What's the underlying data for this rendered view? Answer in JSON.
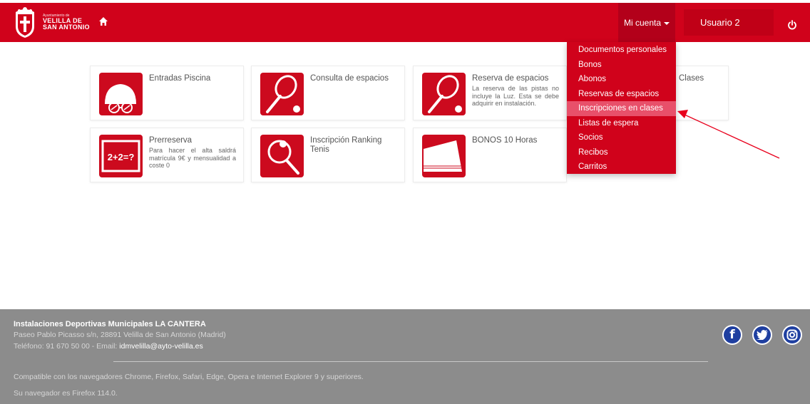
{
  "header": {
    "logo_small": "Ayuntamiento de",
    "logo_line1": "VELILLA DE",
    "logo_line2": "SAN ANTONIO",
    "account_label": "Mi cuenta",
    "user_label": "Usuario 2",
    "brand_color": "#d0021b"
  },
  "dropdown": {
    "items": [
      {
        "label": "Documentos personales"
      },
      {
        "label": "Bonos"
      },
      {
        "label": "Abonos"
      },
      {
        "label": "Reservas de espacios"
      },
      {
        "label": "Inscripciones en clases",
        "highlighted": true
      },
      {
        "label": "Listas de espera"
      },
      {
        "label": "Socios"
      },
      {
        "label": "Recibos"
      },
      {
        "label": "Carritos"
      }
    ]
  },
  "cards": [
    {
      "title": "Entradas Piscina",
      "desc": "",
      "icon": "swim-cap-icon"
    },
    {
      "title": "Consulta de espacios",
      "desc": "",
      "icon": "tennis-racket-icon"
    },
    {
      "title": "Reserva de espacios",
      "desc": "La reserva de las pistas no incluye la Luz. Esta se debe adquirir en instalación.",
      "icon": "tennis-racket-icon"
    },
    {
      "title": "Clases",
      "desc": "",
      "icon": "classes-icon"
    },
    {
      "title": "Prerreserva",
      "desc": "Para hacer el alta saldrá matrícula 9€ y mensualidad a coste 0",
      "icon": "blackboard-icon"
    },
    {
      "title": "Inscripción Ranking Tenis",
      "desc": "",
      "icon": "tennis-ranking-icon"
    },
    {
      "title": "BONOS 10 Horas",
      "desc": "",
      "icon": "voucher-icon"
    }
  ],
  "blackboard_text": "2+2=?",
  "footer": {
    "name": "Instalaciones Deportivas Municipales LA CANTERA",
    "address": "Paseo Pablo Picasso s/n, 28891 Velilla de San Antonio (Madrid)",
    "phone_prefix": "Teléfono: 91 670 50 00 - Email: ",
    "email": "idmvelilla@ayto-velilla.es",
    "compat": "Compatible con los navegadores Chrome, Firefox, Safari, Edge, Opera e Internet Explorer 9 y superiores.",
    "browser": "Su navegador es Firefox 114.0."
  },
  "social": [
    "facebook-icon",
    "twitter-icon",
    "instagram-icon"
  ]
}
